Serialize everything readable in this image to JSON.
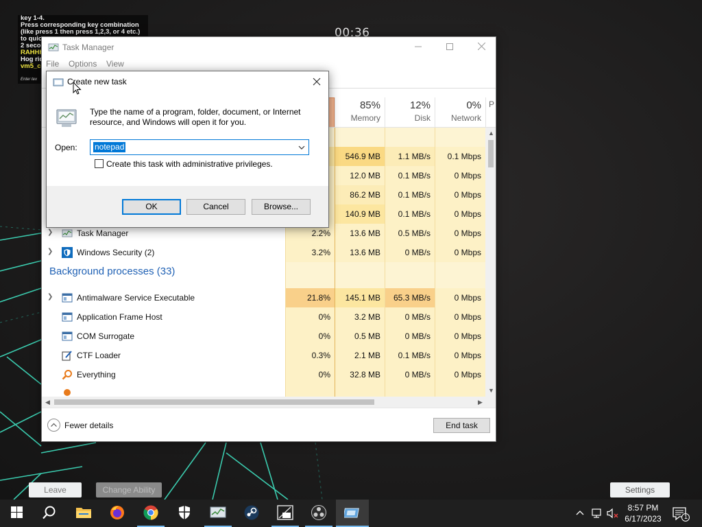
{
  "overlay": {
    "lines": [
      "key 1-4.",
      "Press corresponding key combination",
      "(like press 1 then press 1,2,3, or 4 etc.)",
      "to quic",
      "2 secon",
      "RAHHH",
      "Hog rid",
      "vm5_c"
    ],
    "hint": "Enter tex",
    "timer": "00:36"
  },
  "game_buttons": {
    "leave": "Leave",
    "change_ability": "Change Ability",
    "settings": "Settings"
  },
  "task_manager": {
    "title": "Task Manager",
    "menu": [
      "File",
      "Options",
      "View"
    ],
    "columns": [
      {
        "pct": "85%",
        "label": "Memory"
      },
      {
        "pct": "12%",
        "label": "Disk"
      },
      {
        "pct": "0%",
        "label": "Network"
      },
      {
        "pct": "",
        "label": "P"
      }
    ],
    "rows": [
      {
        "name": "",
        "cpu": "",
        "mem": "",
        "disk": "",
        "net": ""
      },
      {
        "name": "",
        "cpu": "",
        "mem": "546.9 MB",
        "disk": "1.1 MB/s",
        "net": "0.1 Mbps"
      },
      {
        "name": "",
        "cpu": "",
        "mem": "12.0 MB",
        "disk": "0.1 MB/s",
        "net": "0 Mbps"
      },
      {
        "name": "",
        "cpu": "",
        "mem": "86.2 MB",
        "disk": "0.1 MB/s",
        "net": "0 Mbps"
      },
      {
        "name": "",
        "cpu": "",
        "mem": "140.9 MB",
        "disk": "0.1 MB/s",
        "net": "0 Mbps"
      },
      {
        "name": "Task Manager",
        "cpu": "2.2%",
        "mem": "13.6 MB",
        "disk": "0.5 MB/s",
        "net": "0 Mbps"
      },
      {
        "name": "Windows Security (2)",
        "cpu": "3.2%",
        "mem": "13.6 MB",
        "disk": "0 MB/s",
        "net": "0 Mbps"
      }
    ],
    "background_group": "Background processes (33)",
    "bg_rows": [
      {
        "name": "Antimalware Service Executable",
        "cpu": "21.8%",
        "mem": "145.1 MB",
        "disk": "65.3 MB/s",
        "net": "0 Mbps"
      },
      {
        "name": "Application Frame Host",
        "cpu": "0%",
        "mem": "3.2 MB",
        "disk": "0 MB/s",
        "net": "0 Mbps"
      },
      {
        "name": "COM Surrogate",
        "cpu": "0%",
        "mem": "0.5 MB",
        "disk": "0 MB/s",
        "net": "0 Mbps"
      },
      {
        "name": "CTF Loader",
        "cpu": "0.3%",
        "mem": "2.1 MB",
        "disk": "0.1 MB/s",
        "net": "0 Mbps"
      },
      {
        "name": "Everything",
        "cpu": "0%",
        "mem": "32.8 MB",
        "disk": "0 MB/s",
        "net": "0 Mbps"
      }
    ],
    "fewer_details": "Fewer details",
    "end_task": "End task"
  },
  "dialog": {
    "title": "Create new task",
    "description": "Type the name of a program, folder, document, or Internet resource, and Windows will open it for you.",
    "open_label": "Open:",
    "open_value": "notepad",
    "admin_checkbox_label": "Create this task with administrative privileges.",
    "admin_checked": false,
    "ok": "OK",
    "cancel": "Cancel",
    "browse": "Browse..."
  },
  "taskbar": {
    "clock_time": "8:57 PM",
    "clock_date": "6/17/2023",
    "notification_count": "1"
  }
}
